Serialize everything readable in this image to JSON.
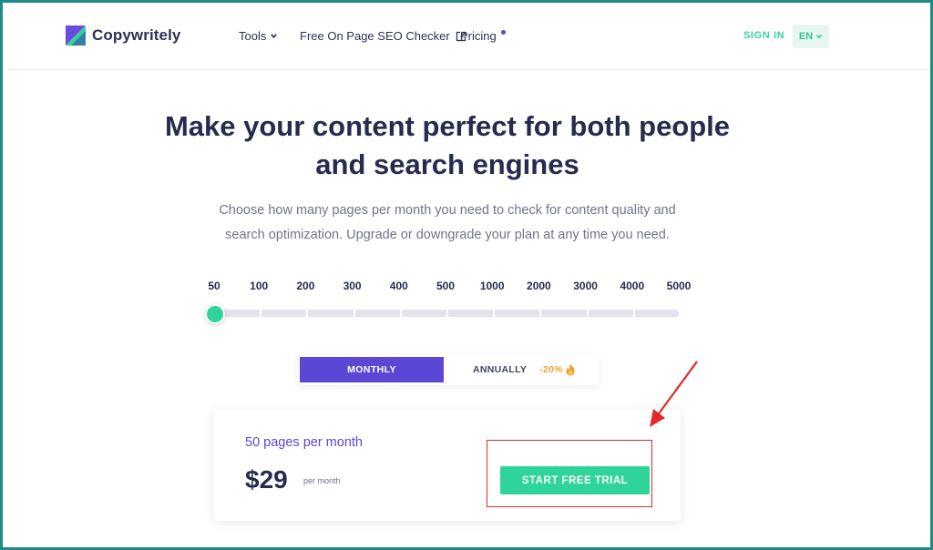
{
  "header": {
    "brand": "Copywritely",
    "nav": {
      "tools": "Tools",
      "seo_checker": "Free On Page SEO Checker",
      "pricing": "Pricing"
    },
    "sign_in": "SIGN IN",
    "language": "EN"
  },
  "hero": {
    "title_line1": "Make your content perfect for both people",
    "title_line2": "and search engines",
    "subtitle_line1": "Choose how many pages per month you need to check for content quality and",
    "subtitle_line2": "search optimization. Upgrade or downgrade your plan at any time you need."
  },
  "slider": {
    "ticks": [
      "50",
      "100",
      "200",
      "300",
      "400",
      "500",
      "1000",
      "2000",
      "3000",
      "4000",
      "5000"
    ],
    "selected": "50"
  },
  "billing": {
    "monthly": "MONTHLY",
    "annually": "ANNUALLY",
    "discount": "-20%",
    "active": "monthly"
  },
  "plan": {
    "pages": "50 pages per month",
    "price": "$29",
    "period": "per month",
    "cta": "START FREE TRIAL"
  },
  "colors": {
    "accent_green": "#2fd49a",
    "accent_purple": "#5b47d6",
    "highlight_red": "#e02a2a",
    "frame_teal": "#1e8c86"
  },
  "icons": {
    "logo": "copywritely-logo-icon",
    "chevron": "chevron-down-icon",
    "external": "external-link-icon",
    "flame": "flame-icon",
    "arrow": "annotation-arrow-icon"
  }
}
